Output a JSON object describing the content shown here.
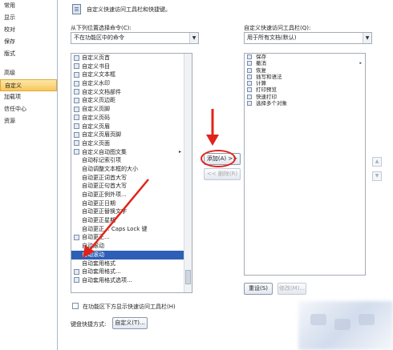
{
  "nav": {
    "items": [
      "常用",
      "显示",
      "校对",
      "保存",
      "版式",
      "高级",
      "自定义",
      "加载项",
      "信任中心",
      "资源"
    ],
    "selected_index": 6
  },
  "header": {
    "text": "自定义快速访问工具栏和快捷键。"
  },
  "left_panel": {
    "choose_label": "从下列位置选择命令(C):",
    "choose_value": "不在功能区中的命令",
    "commands": [
      {
        "label": "自定义页首",
        "icon": true
      },
      {
        "label": "自定义书目",
        "icon": true
      },
      {
        "label": "自定义文本框",
        "icon": true
      },
      {
        "label": "自定义水印",
        "icon": true
      },
      {
        "label": "自定义文档部件",
        "icon": true
      },
      {
        "label": "自定义页边距",
        "icon": true
      },
      {
        "label": "自定义页脚",
        "icon": true
      },
      {
        "label": "自定义页码",
        "icon": true
      },
      {
        "label": "自定义页眉",
        "icon": true
      },
      {
        "label": "自定义页眉页脚",
        "icon": true
      },
      {
        "label": "自定义页面",
        "icon": true
      },
      {
        "label": "自定义自动图文集",
        "icon": true,
        "submenu": true
      },
      {
        "label": "自动标记索引项",
        "icon": false
      },
      {
        "label": "自动调整文本框的大小",
        "icon": false
      },
      {
        "label": "自动更正词首大写",
        "icon": false
      },
      {
        "label": "自动更正句首大写",
        "icon": false
      },
      {
        "label": "自动更正例外项...",
        "icon": false
      },
      {
        "label": "自动更正日期",
        "icon": false
      },
      {
        "label": "自动更正替换文字",
        "icon": false
      },
      {
        "label": "自动更正星期",
        "icon": false
      },
      {
        "label": "自动更正... Caps Lock 键",
        "icon": false
      },
      {
        "label": "自动更正...",
        "icon": true
      },
      {
        "label": "自动滚动",
        "icon": false
      },
      {
        "label": "自动滚动",
        "icon": false,
        "selected": true
      },
      {
        "label": "自动套用格式",
        "icon": false
      },
      {
        "label": "自动套用格式...",
        "icon": true
      },
      {
        "label": "自动套用格式选项...",
        "icon": true
      }
    ],
    "checkbox_label": "在功能区下方显示快速访问工具栏(H)",
    "shortcut_label": "键盘快捷方式:",
    "customize_button": "自定义(T)..."
  },
  "middle": {
    "add_button": "添加(A) >>",
    "remove_button": "<< 删除(R)"
  },
  "right_panel": {
    "target_label": "自定义快速访问工具栏(Q):",
    "target_value": "用于所有文档(默认)",
    "items": [
      {
        "label": "保存",
        "submenu": false
      },
      {
        "label": "撤消",
        "submenu": true
      },
      {
        "label": "恢复",
        "submenu": false
      },
      {
        "label": "插写和语法",
        "submenu": false
      },
      {
        "label": "计算",
        "submenu": false
      },
      {
        "label": "打印预览",
        "submenu": false
      },
      {
        "label": "快速打印",
        "submenu": false
      },
      {
        "label": "选择多个对象",
        "submenu": false
      }
    ],
    "reset_button": "重设(S)",
    "modify_button": "修改(M)..."
  },
  "colors": {
    "selection": "#2e5fb6",
    "nav_selected": "#f8c75a",
    "annotation": "#e2231a"
  }
}
